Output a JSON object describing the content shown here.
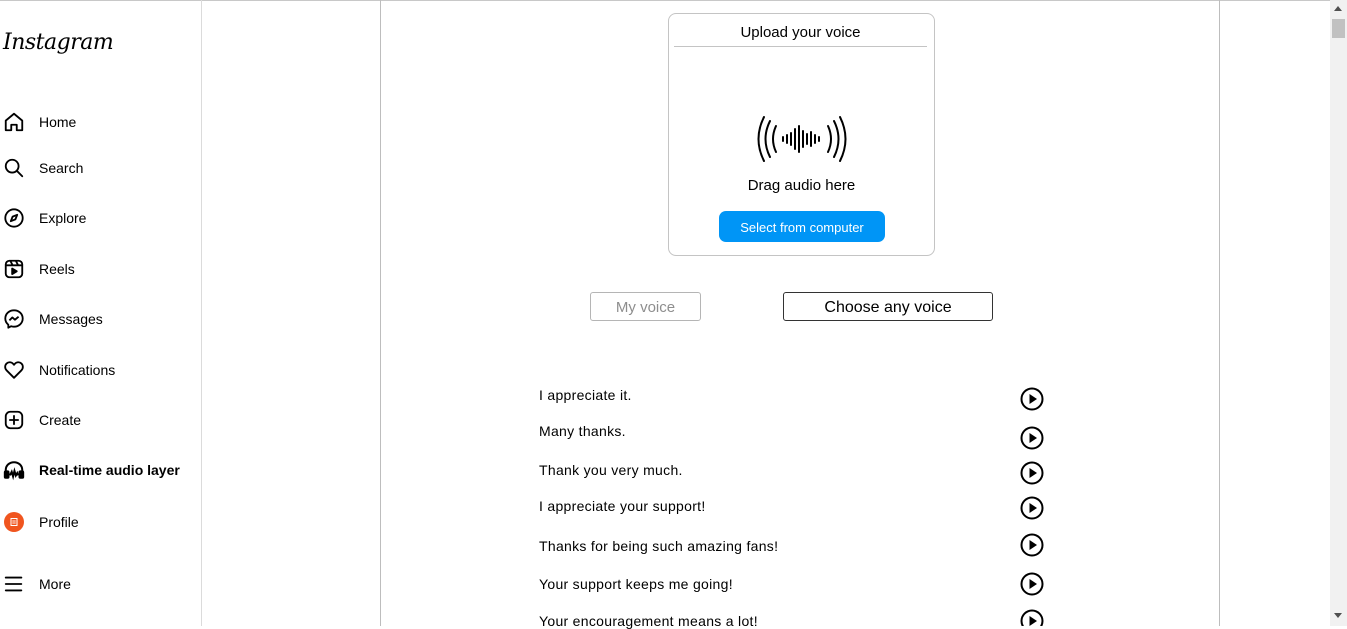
{
  "app": {
    "logo": "Instagram"
  },
  "sidebar": {
    "items": [
      {
        "label": "Home",
        "icon": "home-icon"
      },
      {
        "label": "Search",
        "icon": "search-icon"
      },
      {
        "label": "Explore",
        "icon": "compass-icon"
      },
      {
        "label": "Reels",
        "icon": "reels-icon"
      },
      {
        "label": "Messages",
        "icon": "messenger-icon"
      },
      {
        "label": "Notifications",
        "icon": "heart-icon"
      },
      {
        "label": "Create",
        "icon": "plus-square-icon"
      },
      {
        "label": "Real-time audio layer",
        "icon": "headphones-icon",
        "active": true
      },
      {
        "label": "Profile",
        "icon": "avatar"
      },
      {
        "label": "More",
        "icon": "menu-icon"
      }
    ]
  },
  "upload": {
    "title": "Upload your voice",
    "drag_text": "Drag audio here",
    "select_label": "Select from computer",
    "icon": "sound-wave-icon"
  },
  "voice_options": {
    "my_voice": "My voice",
    "any_voice": "Choose any voice"
  },
  "phrases": [
    "I appreciate it.",
    "Many thanks.",
    "Thank you very much.",
    "I appreciate your support!",
    "Thanks for being such amazing fans!",
    "Your support keeps me going!",
    "Your encouragement means a lot!"
  ],
  "colors": {
    "accent": "#0095f6",
    "avatar": "#f0551f"
  }
}
